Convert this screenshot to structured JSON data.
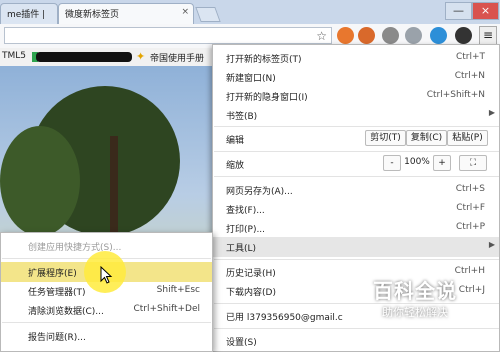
{
  "tabs": [
    {
      "label": "me插件 |",
      "close": "×"
    },
    {
      "label": "微度新标签页",
      "close": "×"
    }
  ],
  "window_controls": {
    "minimize": "—",
    "close": "×"
  },
  "toolbar": {
    "star": "☆",
    "menu_icon": "≡",
    "extension_icons": [
      "orange-circle-icon",
      "dog-icon",
      "gear-icon",
      "gray-circle-icon",
      "blue-circle-icon",
      "black-logo-icon"
    ]
  },
  "bookmarks": {
    "html5": "TML5",
    "manual": "帝国使用手册"
  },
  "main_menu": {
    "items": [
      {
        "label": "打开新的标签页(T)",
        "shortcut": "Ctrl+T"
      },
      {
        "label": "新建窗口(N)",
        "shortcut": "Ctrl+N"
      },
      {
        "label": "打开新的隐身窗口(I)",
        "shortcut": "Ctrl+Shift+N"
      },
      {
        "label": "书签(B)",
        "arrow": "▶"
      }
    ],
    "edit": {
      "label": "编辑",
      "cut": "剪切(T)",
      "copy": "复制(C)",
      "paste": "粘贴(P)"
    },
    "zoom": {
      "label": "缩放",
      "minus": "-",
      "value": "100%",
      "plus": "+",
      "fullscreen": "⛶"
    },
    "page_items": [
      {
        "label": "网页另存为(A)...",
        "shortcut": "Ctrl+S"
      },
      {
        "label": "查找(F)...",
        "shortcut": "Ctrl+F"
      },
      {
        "label": "打印(P)...",
        "shortcut": "Ctrl+P"
      },
      {
        "label": "工具(L)",
        "arrow": "▶"
      }
    ],
    "history": {
      "label": "历史记录(H)",
      "shortcut": "Ctrl+H"
    },
    "downloads": {
      "label": "下载内容(D)",
      "shortcut": "Ctrl+J"
    },
    "signed_in": {
      "label": "已用 l379356950@gmail.c"
    },
    "settings": {
      "label": "设置(S)"
    }
  },
  "tools_submenu": {
    "items": [
      {
        "label": "创建应用快捷方式(S)...",
        "shortcut": ""
      },
      {
        "label": "扩展程序(E)",
        "shortcut": ""
      },
      {
        "label": "任务管理器(T)",
        "shortcut": "Shift+Esc"
      },
      {
        "label": "清除浏览数据(C)...",
        "shortcut": "Ctrl+Shift+Del"
      },
      {
        "label": "报告问题(R)...",
        "shortcut": ""
      }
    ]
  },
  "watermark": {
    "title": "百科全说",
    "subtitle": "助你轻松解决"
  },
  "colors": {
    "highlight": "#f3e58a",
    "disabled": "#9a9a9a",
    "hover_row": "#e6e6e6"
  }
}
